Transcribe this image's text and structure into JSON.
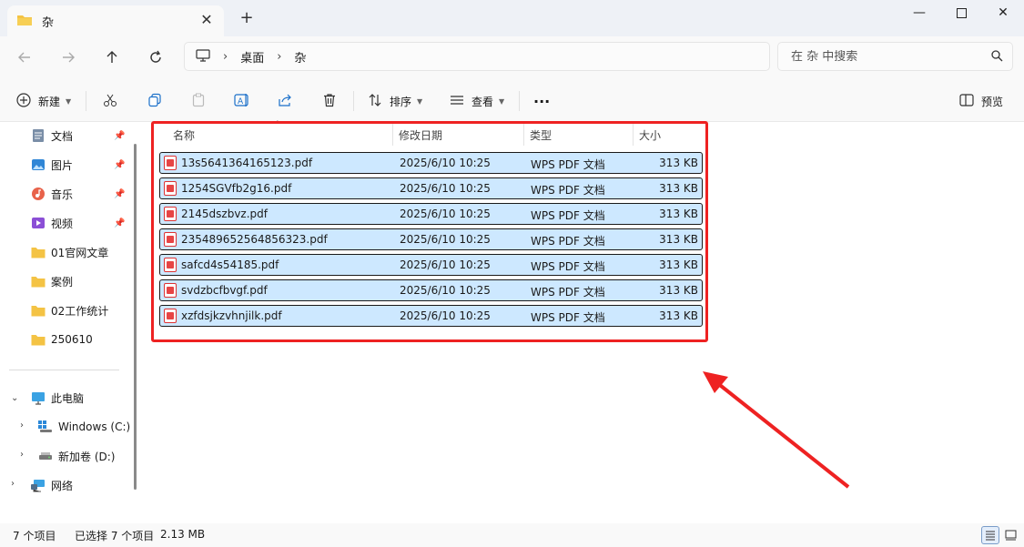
{
  "tab": {
    "title": "杂"
  },
  "address": {
    "crumbs": [
      "桌面",
      "杂"
    ]
  },
  "search": {
    "placeholder": "在 杂 中搜索"
  },
  "toolbar": {
    "new_label": "新建",
    "sort_label": "排序",
    "view_label": "查看",
    "more_label": "···",
    "preview_label": "预览"
  },
  "sidebar": {
    "quick": [
      {
        "label": "文档",
        "icon": "document-icon"
      },
      {
        "label": "图片",
        "icon": "pictures-icon"
      },
      {
        "label": "音乐",
        "icon": "music-icon"
      },
      {
        "label": "视频",
        "icon": "video-icon"
      },
      {
        "label": "01官网文章",
        "icon": "folder-icon"
      },
      {
        "label": "案例",
        "icon": "folder-icon"
      },
      {
        "label": "02工作统计",
        "icon": "folder-icon"
      },
      {
        "label": "250610",
        "icon": "folder-icon"
      }
    ],
    "tree": [
      {
        "label": "此电脑",
        "icon": "computer-icon"
      },
      {
        "label": "Windows (C:)",
        "icon": "drive-icon"
      },
      {
        "label": "新加卷 (D:)",
        "icon": "drive-icon"
      },
      {
        "label": "网络",
        "icon": "network-icon"
      }
    ]
  },
  "columns": {
    "name": "名称",
    "date": "修改日期",
    "type": "类型",
    "size": "大小"
  },
  "files": [
    {
      "name": "13s5641364165123.pdf",
      "date": "2025/6/10 10:25",
      "type": "WPS PDF 文档",
      "size": "313 KB"
    },
    {
      "name": "1254SGVfb2g16.pdf",
      "date": "2025/6/10 10:25",
      "type": "WPS PDF 文档",
      "size": "313 KB"
    },
    {
      "name": "2145dszbvz.pdf",
      "date": "2025/6/10 10:25",
      "type": "WPS PDF 文档",
      "size": "313 KB"
    },
    {
      "name": "235489652564856323.pdf",
      "date": "2025/6/10 10:25",
      "type": "WPS PDF 文档",
      "size": "313 KB"
    },
    {
      "name": "safcd4s54185.pdf",
      "date": "2025/6/10 10:25",
      "type": "WPS PDF 文档",
      "size": "313 KB"
    },
    {
      "name": "svdzbcfbvgf.pdf",
      "date": "2025/6/10 10:25",
      "type": "WPS PDF 文档",
      "size": "313 KB"
    },
    {
      "name": "xzfdsjkzvhnjilk.pdf",
      "date": "2025/6/10 10:25",
      "type": "WPS PDF 文档",
      "size": "313 KB"
    }
  ],
  "status": {
    "count": "7 个项目",
    "selected": "已选择 7 个项目",
    "size": "2.13 MB"
  },
  "colors": {
    "selection": "#cde8ff",
    "highlight": "#ee2222",
    "folder": "#f4c344"
  }
}
